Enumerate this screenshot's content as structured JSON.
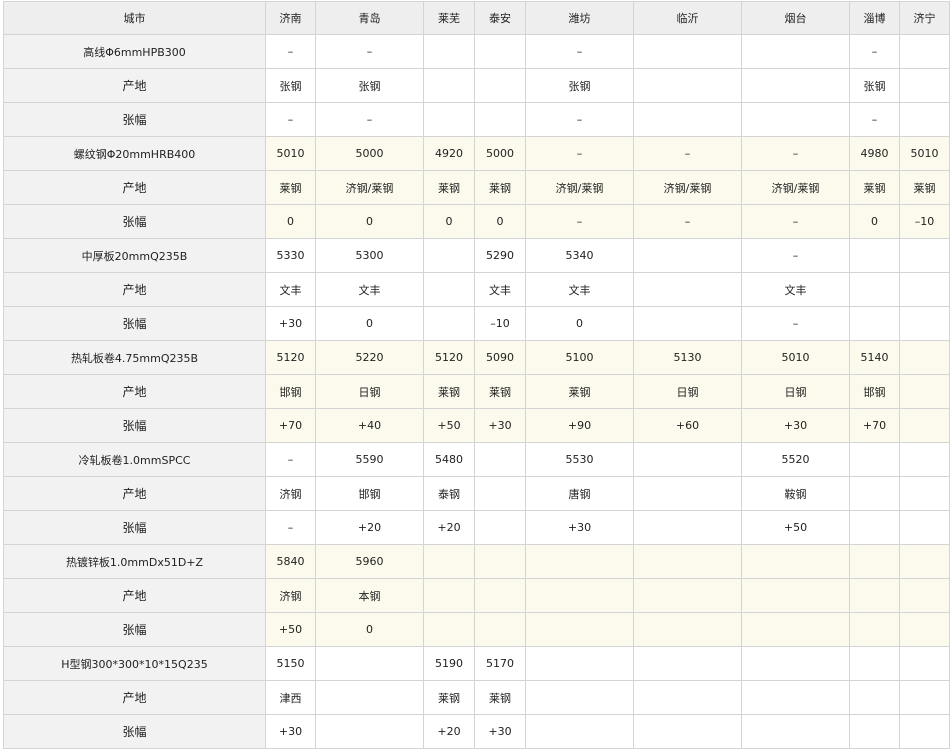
{
  "header": {
    "corner_label": "城市",
    "cities": [
      "济南",
      "青岛",
      "莱芜",
      "泰安",
      "潍坊",
      "临沂",
      "烟台",
      "淄博",
      "济宁"
    ]
  },
  "rows": [
    {
      "label": "高线Φ6mmHPB300",
      "kind": "product",
      "shaded": false,
      "cells": [
        "–",
        "–",
        "",
        "",
        "–",
        "",
        "",
        "–",
        ""
      ]
    },
    {
      "label": "产地",
      "kind": "sub",
      "shaded": false,
      "cells": [
        "张钢",
        "张钢",
        "",
        "",
        "张钢",
        "",
        "",
        "张钢",
        ""
      ]
    },
    {
      "label": "张幅",
      "kind": "sub",
      "shaded": false,
      "cells": [
        "–",
        "–",
        "",
        "",
        "–",
        "",
        "",
        "–",
        ""
      ]
    },
    {
      "label": "螺纹钢Φ20mmHRB400",
      "kind": "product",
      "shaded": true,
      "cells": [
        "5010",
        "5000",
        "4920",
        "5000",
        "–",
        "–",
        "–",
        "4980",
        "5010"
      ]
    },
    {
      "label": "产地",
      "kind": "sub",
      "shaded": true,
      "cells": [
        "莱钢",
        "济钢/莱钢",
        "莱钢",
        "莱钢",
        "济钢/莱钢",
        "济钢/莱钢",
        "济钢/莱钢",
        "莱钢",
        "莱钢"
      ]
    },
    {
      "label": "张幅",
      "kind": "sub",
      "shaded": true,
      "cells": [
        "0",
        "0",
        "0",
        "0",
        "–",
        "–",
        "–",
        "0",
        "–10"
      ]
    },
    {
      "label": "中厚板20mmQ235B",
      "kind": "product",
      "shaded": false,
      "cells": [
        "5330",
        "5300",
        "",
        "5290",
        "5340",
        "",
        "–",
        "",
        ""
      ]
    },
    {
      "label": "产地",
      "kind": "sub",
      "shaded": false,
      "cells": [
        "文丰",
        "文丰",
        "",
        "文丰",
        "文丰",
        "",
        "文丰",
        "",
        ""
      ]
    },
    {
      "label": "张幅",
      "kind": "sub",
      "shaded": false,
      "cells": [
        "+30",
        "0",
        "",
        "–10",
        "0",
        "",
        "–",
        "",
        ""
      ]
    },
    {
      "label": "热轧板卷4.75mmQ235B",
      "kind": "product",
      "shaded": true,
      "cells": [
        "5120",
        "5220",
        "5120",
        "5090",
        "5100",
        "5130",
        "5010",
        "5140",
        ""
      ]
    },
    {
      "label": "产地",
      "kind": "sub",
      "shaded": true,
      "cells": [
        "邯钢",
        "日钢",
        "莱钢",
        "莱钢",
        "莱钢",
        "日钢",
        "日钢",
        "邯钢",
        ""
      ]
    },
    {
      "label": "张幅",
      "kind": "sub",
      "shaded": true,
      "cells": [
        "+70",
        "+40",
        "+50",
        "+30",
        "+90",
        "+60",
        "+30",
        "+70",
        ""
      ]
    },
    {
      "label": "冷轧板卷1.0mmSPCC",
      "kind": "product",
      "shaded": false,
      "cells": [
        "–",
        "5590",
        "5480",
        "",
        "5530",
        "",
        "5520",
        "",
        ""
      ]
    },
    {
      "label": "产地",
      "kind": "sub",
      "shaded": false,
      "cells": [
        "济钢",
        "邯钢",
        "泰钢",
        "",
        "唐钢",
        "",
        "鞍钢",
        "",
        ""
      ]
    },
    {
      "label": "张幅",
      "kind": "sub",
      "shaded": false,
      "cells": [
        "–",
        "+20",
        "+20",
        "",
        "+30",
        "",
        "+50",
        "",
        ""
      ]
    },
    {
      "label": "热镀锌板1.0mmDx51D+Z",
      "kind": "product",
      "shaded": true,
      "cells": [
        "5840",
        "5960",
        "",
        "",
        "",
        "",
        "",
        "",
        ""
      ]
    },
    {
      "label": "产地",
      "kind": "sub",
      "shaded": true,
      "cells": [
        "济钢",
        "本钢",
        "",
        "",
        "",
        "",
        "",
        "",
        ""
      ]
    },
    {
      "label": "张幅",
      "kind": "sub",
      "shaded": true,
      "cells": [
        "+50",
        "0",
        "",
        "",
        "",
        "",
        "",
        "",
        ""
      ]
    },
    {
      "label": "H型钢300*300*10*15Q235",
      "kind": "product",
      "shaded": false,
      "cells": [
        "5150",
        "",
        "5190",
        "5170",
        "",
        "",
        "",
        "",
        ""
      ]
    },
    {
      "label": "产地",
      "kind": "sub",
      "shaded": false,
      "cells": [
        "津西",
        "",
        "莱钢",
        "莱钢",
        "",
        "",
        "",
        "",
        ""
      ]
    },
    {
      "label": "张幅",
      "kind": "sub",
      "shaded": false,
      "cells": [
        "+30",
        "",
        "+20",
        "+30",
        "",
        "",
        "",
        "",
        ""
      ]
    }
  ],
  "colors": {
    "header_bg": "#eeeeee",
    "label_col_bg": "#f2f2f2",
    "shaded_row_bg": "#fcfaec",
    "border": "#d4d4d4"
  }
}
